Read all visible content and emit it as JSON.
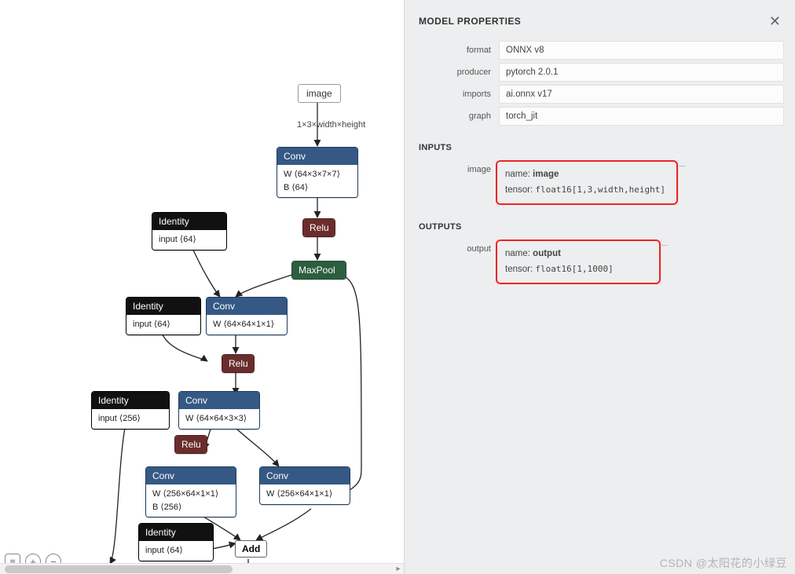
{
  "panel": {
    "title": "MODEL PROPERTIES",
    "close_glyph": "✕",
    "props": {
      "format": {
        "label": "format",
        "value": "ONNX v8"
      },
      "producer": {
        "label": "producer",
        "value": "pytorch 2.0.1"
      },
      "imports": {
        "label": "imports",
        "value": "ai.onnx v17"
      },
      "graph": {
        "label": "graph",
        "value": "torch_jit"
      }
    },
    "sections": {
      "inputs": "INPUTS",
      "outputs": "OUTPUTS"
    },
    "inputs": {
      "image": {
        "label": "image",
        "name_label": "name:",
        "name_value": "image",
        "tensor_label": "tensor:",
        "tensor_value": "float16[1,3,width,height]",
        "collapse_glyph": "–"
      }
    },
    "outputs": {
      "output": {
        "label": "output",
        "name_label": "name:",
        "name_value": "output",
        "tensor_label": "tensor:",
        "tensor_value": "float16[1,1000]",
        "collapse_glyph": "–"
      }
    }
  },
  "watermark": "CSDN @太阳花的小绿豆",
  "toolbar": {
    "list_glyph": "≡",
    "zoom_in_glyph": "+",
    "zoom_out_glyph": "−"
  },
  "graph": {
    "input_node": {
      "label": "image"
    },
    "edge_label_input": "1×3×width×height",
    "nodes": {
      "conv1": {
        "title": "Conv",
        "lines": [
          "W  ⟨64×3×7×7⟩",
          "B  ⟨64⟩"
        ]
      },
      "relu1": {
        "title": "Relu"
      },
      "maxpool": {
        "title": "MaxPool"
      },
      "id1": {
        "title": "Identity",
        "lines": [
          "input  ⟨64⟩"
        ]
      },
      "id2": {
        "title": "Identity",
        "lines": [
          "input  ⟨64⟩"
        ]
      },
      "conv2": {
        "title": "Conv",
        "lines": [
          "W  ⟨64×64×1×1⟩"
        ]
      },
      "relu2": {
        "title": "Relu"
      },
      "id3": {
        "title": "Identity",
        "lines": [
          "input  ⟨256⟩"
        ]
      },
      "conv3": {
        "title": "Conv",
        "lines": [
          "W  ⟨64×64×3×3⟩"
        ]
      },
      "relu3": {
        "title": "Relu"
      },
      "conv4": {
        "title": "Conv",
        "lines": [
          "W  ⟨256×64×1×1⟩",
          "B  ⟨256⟩"
        ]
      },
      "conv5": {
        "title": "Conv",
        "lines": [
          "W  ⟨256×64×1×1⟩"
        ]
      },
      "id4": {
        "title": "Identity",
        "lines": [
          "input  ⟨64⟩"
        ]
      },
      "add": {
        "title": "Add"
      }
    }
  }
}
